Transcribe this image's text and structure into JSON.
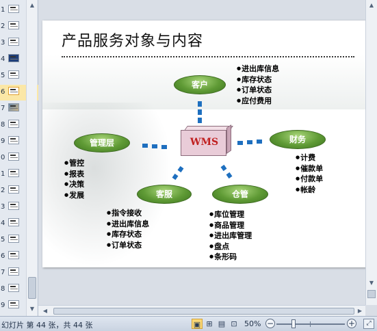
{
  "thumbnails": [
    {
      "num": "1",
      "style": "plain"
    },
    {
      "num": "2",
      "style": "plain"
    },
    {
      "num": "3",
      "style": "plain"
    },
    {
      "num": "4",
      "style": "dark"
    },
    {
      "num": "5",
      "style": "plain"
    },
    {
      "num": "6",
      "style": "selected"
    },
    {
      "num": "7",
      "style": "photo"
    },
    {
      "num": "8",
      "style": "plain"
    },
    {
      "num": "9",
      "style": "plain"
    },
    {
      "num": "0",
      "style": "plain"
    },
    {
      "num": "1",
      "style": "plain"
    },
    {
      "num": "2",
      "style": "plain"
    },
    {
      "num": "3",
      "style": "plain"
    },
    {
      "num": "4",
      "style": "plain"
    },
    {
      "num": "5",
      "style": "plain"
    },
    {
      "num": "6",
      "style": "plain"
    },
    {
      "num": "7",
      "style": "plain"
    },
    {
      "num": "8",
      "style": "plain"
    },
    {
      "num": "9",
      "style": "plain"
    }
  ],
  "slide": {
    "title": "产品服务对象与内容",
    "center_label": "WMS",
    "nodes": {
      "customer": "客户",
      "management": "管理层",
      "finance": "财务",
      "service": "客服",
      "warehouse": "仓管"
    },
    "lists": {
      "customer": [
        "进出库信息",
        "库存状态",
        "订单状态",
        "应付费用"
      ],
      "management": [
        "管控",
        "报表",
        "决策",
        "发展"
      ],
      "finance": [
        "计费",
        "催款单",
        "付款单",
        "帐龄"
      ],
      "service": [
        "指令接收",
        "进出库信息",
        "库存状态",
        "订单状态"
      ],
      "warehouse": [
        "库位管理",
        "商品管理",
        "进出库管理",
        "盘点",
        "条形码"
      ]
    }
  },
  "statusbar": {
    "text": "幻灯片 第 44 张，共 44 张",
    "zoom": "50%",
    "zoom_minus": "−",
    "zoom_plus": "+"
  },
  "colors": {
    "node_green": "#5f9a35",
    "connector_blue": "#1e6fbf",
    "wms_text": "#c02020",
    "selected_thumb": "#fbe7a6"
  },
  "icons": {
    "scroll_up": "up-arrow-icon",
    "scroll_down": "down-arrow-icon",
    "normal_view": "normal-view-icon",
    "slide_sorter": "slide-sorter-icon",
    "reading_view": "reading-view-icon",
    "slideshow": "slideshow-icon",
    "fit_window": "fit-window-icon"
  }
}
